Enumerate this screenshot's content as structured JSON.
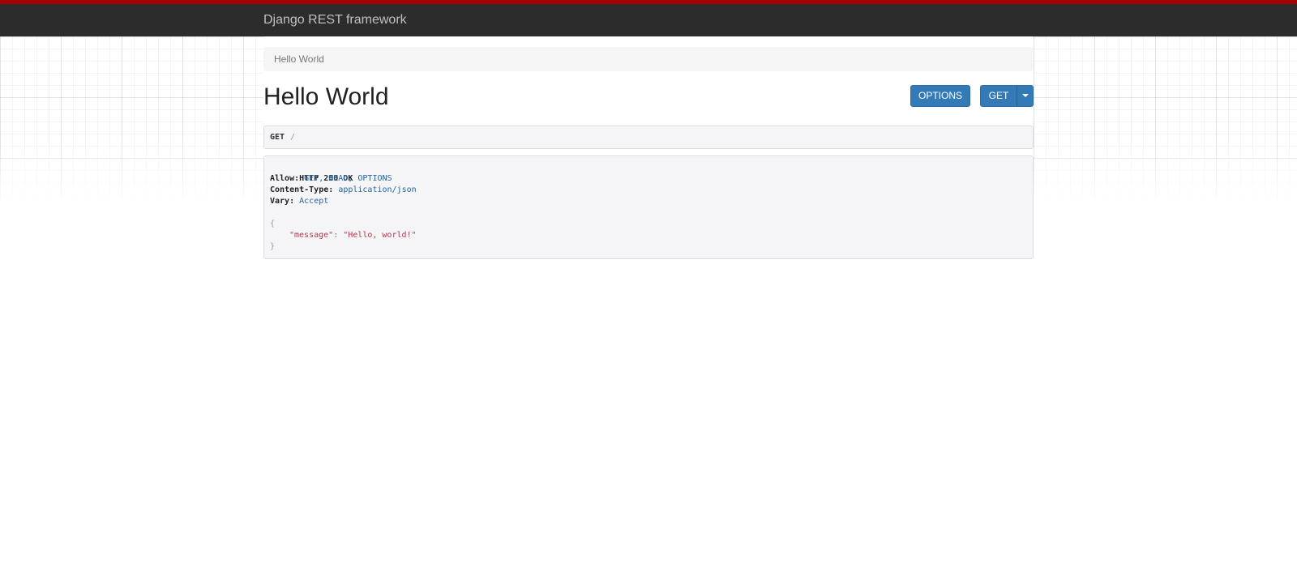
{
  "navbar": {
    "brand": "Django REST framework"
  },
  "breadcrumb": {
    "items": [
      "Hello World"
    ]
  },
  "page": {
    "title": "Hello World"
  },
  "actions": {
    "options_label": "OPTIONS",
    "get_label": "GET"
  },
  "request": {
    "method": "GET",
    "path": "/"
  },
  "response": {
    "status_line": "HTTP 200 OK",
    "headers": [
      {
        "key": "Allow:",
        "value": "GET, HEAD, OPTIONS"
      },
      {
        "key": "Content-Type:",
        "value": "application/json"
      },
      {
        "key": "Vary:",
        "value": "Accept"
      }
    ],
    "body": {
      "open_brace": "{",
      "key": "\"message\"",
      "colon": ":",
      "value": "\"Hello, world!\"",
      "close_brace": "}"
    }
  },
  "colors": {
    "top_stripe": "#a30000",
    "navbar_bg": "#2c2c2c",
    "button_primary": "#337ab7",
    "header_value": "#2c6496",
    "json_string": "#b03a51"
  }
}
